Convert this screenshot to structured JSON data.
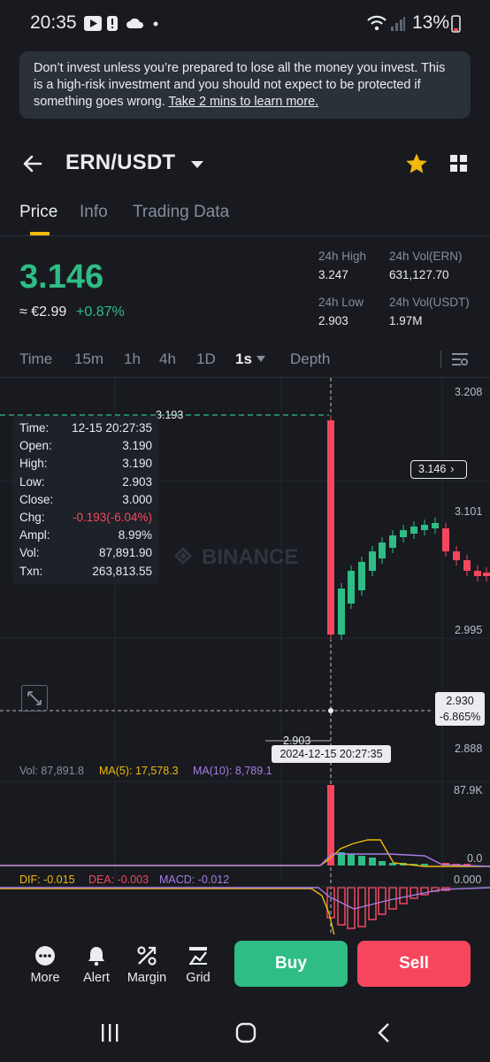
{
  "status_bar": {
    "time": "20:35",
    "battery": "13%"
  },
  "disclaimer": {
    "text": "Don’t invest unless you’re prepared to lose all the money you invest. This is a high-risk investment and you should not expect to be protected if something goes wrong.",
    "link": "Take 2 mins to learn more."
  },
  "header": {
    "pair": "ERN/USDT"
  },
  "tabs": [
    "Price",
    "Info",
    "Trading Data"
  ],
  "price": {
    "last": "3.146",
    "fiat": "≈ €2.99",
    "change": "+0.87%"
  },
  "stats": {
    "high_label": "24h High",
    "high": "3.247",
    "low_label": "24h Low",
    "low": "2.903",
    "vol_base_label": "24h Vol(ERN)",
    "vol_base": "631,127.70",
    "vol_quote_label": "24h Vol(USDT)",
    "vol_quote": "1.97M"
  },
  "timeframes": [
    "Time",
    "15m",
    "1h",
    "4h",
    "1D",
    "1s",
    "Depth"
  ],
  "chart": {
    "watermark": "BINANCE",
    "y_ticks": [
      "3.208",
      "3.101",
      "2.995",
      "2.888"
    ],
    "last_price_tag": "3.146",
    "crosshair_price": "2.930",
    "crosshair_pct": "-6.865%",
    "crosshair_time": "2024-12-15 20:27:35",
    "high_mark": "3.193",
    "low_mark": "2.903",
    "colors": {
      "up": "#2ebd85",
      "down": "#f6465d",
      "bg": "#181a20",
      "accent": "#f0b90b"
    }
  },
  "tooltip": {
    "rows": [
      {
        "k": "Time:",
        "v": "12-15 20:27:35"
      },
      {
        "k": "Open:",
        "v": "3.190"
      },
      {
        "k": "High:",
        "v": "3.190"
      },
      {
        "k": "Low:",
        "v": "2.903"
      },
      {
        "k": "Close:",
        "v": "3.000"
      },
      {
        "k": "Chg:",
        "v": "-0.193(-6.04%)"
      },
      {
        "k": "Ampl:",
        "v": "8.99%"
      },
      {
        "k": "Vol:",
        "v": "87,891.90"
      },
      {
        "k": "Txn:",
        "v": "263,813.55"
      }
    ]
  },
  "volume": {
    "vol": "Vol: 87,891.8",
    "ma5": "MA(5): 17,578.3",
    "ma10": "MA(10): 8,789.1",
    "y_top": "87.9K",
    "y_zero": "0.0"
  },
  "macd": {
    "dif": "DIF: -0.015",
    "dea": "DEA: -0.003",
    "macd": "MACD: -0.012",
    "y_zero": "0.000"
  },
  "toolbar": {
    "more": "More",
    "alert": "Alert",
    "margin": "Margin",
    "grid": "Grid",
    "buy": "Buy",
    "sell": "Sell"
  }
}
